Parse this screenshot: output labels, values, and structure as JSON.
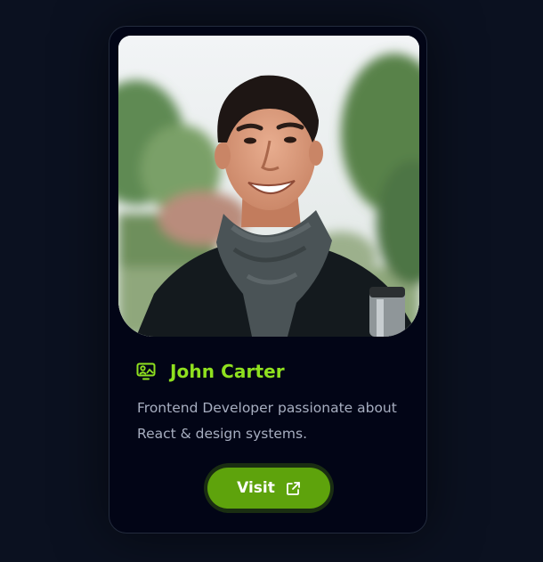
{
  "profile": {
    "name": "John Carter",
    "bio": "Frontend Developer passionate about React & design systems.",
    "name_icon": "portrait-icon",
    "photo_subject": "profile-photo"
  },
  "actions": {
    "visit_label": "Visit",
    "visit_icon": "external-link-icon"
  },
  "colors": {
    "page_bg": "#0b1120",
    "card_bg": "#020516",
    "accent": "#8fe01f",
    "button_bg": "#5ea30c",
    "bio_text": "#a7aec0"
  }
}
